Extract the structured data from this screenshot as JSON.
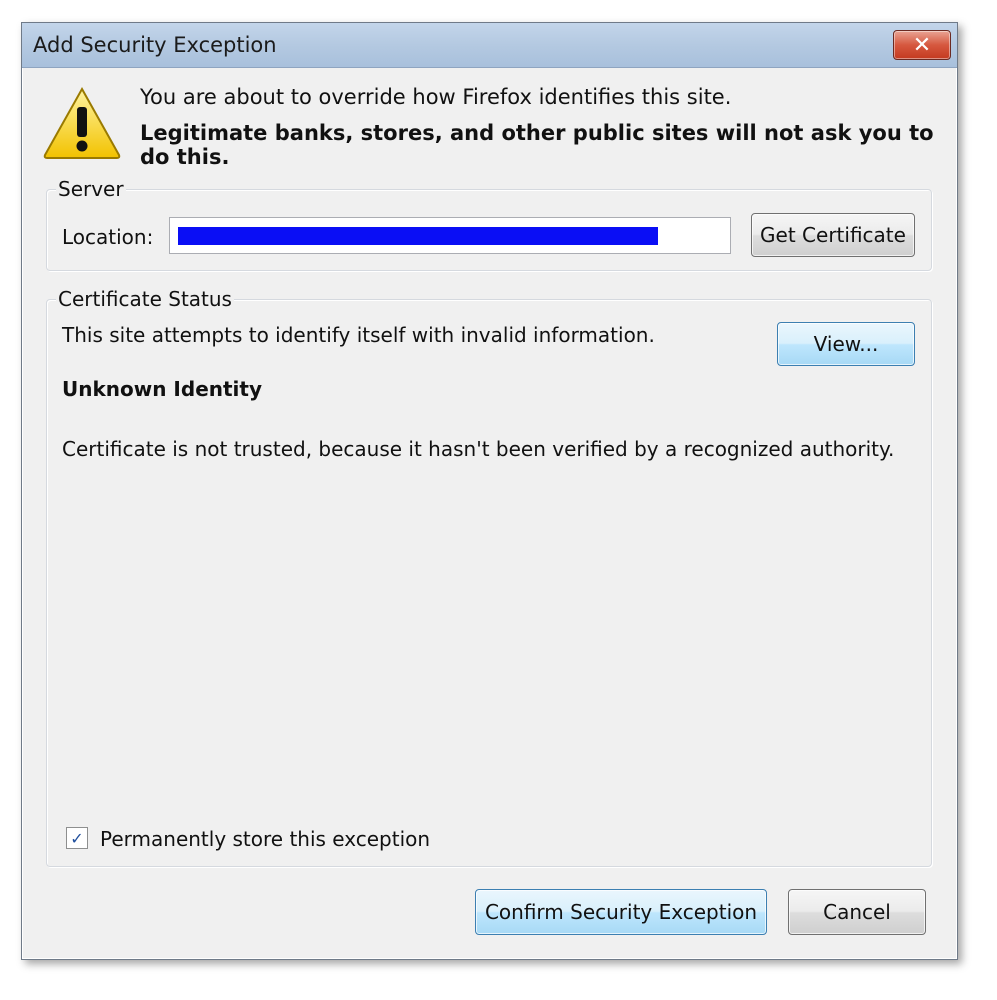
{
  "window": {
    "title": "Add Security Exception",
    "close_glyph": "✕"
  },
  "warning": {
    "icon": "warning-triangle-icon",
    "line1": "You are about to override how Firefox identifies this site.",
    "line2": "Legitimate banks, stores, and other public sites will not ask you to do this."
  },
  "server": {
    "group_label": "Server",
    "location_label": "Location:",
    "location_value": "",
    "get_certificate_label": "Get Certificate"
  },
  "certificate_status": {
    "group_label": "Certificate Status",
    "description": "This site attempts to identify itself with invalid information.",
    "view_label": "View...",
    "heading": "Unknown Identity",
    "detail": "Certificate is not trusted, because it hasn't been verified by a recognized authority."
  },
  "permanent": {
    "checked": true,
    "label": "Permanently store this exception"
  },
  "buttons": {
    "confirm_label": "Confirm Security Exception",
    "cancel_label": "Cancel"
  },
  "colors": {
    "redaction": "#0a0ef5",
    "titlebar": "#b4c9e1",
    "close_button": "#d6583f"
  }
}
